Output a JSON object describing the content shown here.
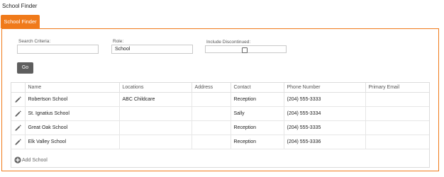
{
  "page": {
    "title": "School Finder"
  },
  "tab": {
    "label": "School Finder"
  },
  "form": {
    "search_label": "Search Criteria:",
    "search_value": "",
    "role_label": "Role:",
    "role_value": "School",
    "discontinued_label": "Include Discontinued:",
    "discontinued_checked": false,
    "go_label": "Go"
  },
  "table": {
    "columns": [
      "Name",
      "Locations",
      "Address",
      "Contact",
      "Phone Number",
      "Primary Email"
    ],
    "rows": [
      [
        "Robertson School",
        "ABC Childcare",
        "",
        "Reception",
        "(204) 555-3333",
        ""
      ],
      [
        "St. Ignatius School",
        "",
        "",
        "Sally",
        "(204) 555-3334",
        ""
      ],
      [
        "Great Oak School",
        "",
        "",
        "Reception",
        "(204) 555-3335",
        ""
      ],
      [
        "Elk Valley School",
        "",
        "",
        "Reception",
        "(204) 555-3336",
        ""
      ]
    ],
    "add_label": "Add School"
  },
  "icons": {
    "row_edit": "pencil-icon",
    "add": "plus-circle-icon"
  },
  "colors": {
    "accent": "#f07a1a",
    "button": "#5e5e5e"
  }
}
